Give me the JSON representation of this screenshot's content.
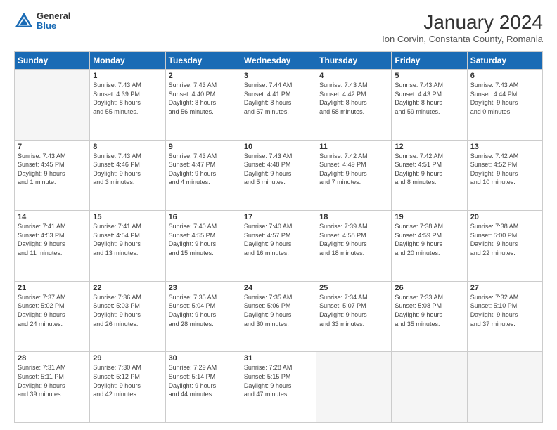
{
  "header": {
    "logo": {
      "general": "General",
      "blue": "Blue"
    },
    "month_year": "January 2024",
    "location": "Ion Corvin, Constanta County, Romania"
  },
  "days_of_week": [
    "Sunday",
    "Monday",
    "Tuesday",
    "Wednesday",
    "Thursday",
    "Friday",
    "Saturday"
  ],
  "weeks": [
    [
      {
        "day": "",
        "info": ""
      },
      {
        "day": "1",
        "info": "Sunrise: 7:43 AM\nSunset: 4:39 PM\nDaylight: 8 hours\nand 55 minutes."
      },
      {
        "day": "2",
        "info": "Sunrise: 7:43 AM\nSunset: 4:40 PM\nDaylight: 8 hours\nand 56 minutes."
      },
      {
        "day": "3",
        "info": "Sunrise: 7:44 AM\nSunset: 4:41 PM\nDaylight: 8 hours\nand 57 minutes."
      },
      {
        "day": "4",
        "info": "Sunrise: 7:43 AM\nSunset: 4:42 PM\nDaylight: 8 hours\nand 58 minutes."
      },
      {
        "day": "5",
        "info": "Sunrise: 7:43 AM\nSunset: 4:43 PM\nDaylight: 8 hours\nand 59 minutes."
      },
      {
        "day": "6",
        "info": "Sunrise: 7:43 AM\nSunset: 4:44 PM\nDaylight: 9 hours\nand 0 minutes."
      }
    ],
    [
      {
        "day": "7",
        "info": "Sunrise: 7:43 AM\nSunset: 4:45 PM\nDaylight: 9 hours\nand 1 minute."
      },
      {
        "day": "8",
        "info": "Sunrise: 7:43 AM\nSunset: 4:46 PM\nDaylight: 9 hours\nand 3 minutes."
      },
      {
        "day": "9",
        "info": "Sunrise: 7:43 AM\nSunset: 4:47 PM\nDaylight: 9 hours\nand 4 minutes."
      },
      {
        "day": "10",
        "info": "Sunrise: 7:43 AM\nSunset: 4:48 PM\nDaylight: 9 hours\nand 5 minutes."
      },
      {
        "day": "11",
        "info": "Sunrise: 7:42 AM\nSunset: 4:49 PM\nDaylight: 9 hours\nand 7 minutes."
      },
      {
        "day": "12",
        "info": "Sunrise: 7:42 AM\nSunset: 4:51 PM\nDaylight: 9 hours\nand 8 minutes."
      },
      {
        "day": "13",
        "info": "Sunrise: 7:42 AM\nSunset: 4:52 PM\nDaylight: 9 hours\nand 10 minutes."
      }
    ],
    [
      {
        "day": "14",
        "info": "Sunrise: 7:41 AM\nSunset: 4:53 PM\nDaylight: 9 hours\nand 11 minutes."
      },
      {
        "day": "15",
        "info": "Sunrise: 7:41 AM\nSunset: 4:54 PM\nDaylight: 9 hours\nand 13 minutes."
      },
      {
        "day": "16",
        "info": "Sunrise: 7:40 AM\nSunset: 4:55 PM\nDaylight: 9 hours\nand 15 minutes."
      },
      {
        "day": "17",
        "info": "Sunrise: 7:40 AM\nSunset: 4:57 PM\nDaylight: 9 hours\nand 16 minutes."
      },
      {
        "day": "18",
        "info": "Sunrise: 7:39 AM\nSunset: 4:58 PM\nDaylight: 9 hours\nand 18 minutes."
      },
      {
        "day": "19",
        "info": "Sunrise: 7:38 AM\nSunset: 4:59 PM\nDaylight: 9 hours\nand 20 minutes."
      },
      {
        "day": "20",
        "info": "Sunrise: 7:38 AM\nSunset: 5:00 PM\nDaylight: 9 hours\nand 22 minutes."
      }
    ],
    [
      {
        "day": "21",
        "info": "Sunrise: 7:37 AM\nSunset: 5:02 PM\nDaylight: 9 hours\nand 24 minutes."
      },
      {
        "day": "22",
        "info": "Sunrise: 7:36 AM\nSunset: 5:03 PM\nDaylight: 9 hours\nand 26 minutes."
      },
      {
        "day": "23",
        "info": "Sunrise: 7:35 AM\nSunset: 5:04 PM\nDaylight: 9 hours\nand 28 minutes."
      },
      {
        "day": "24",
        "info": "Sunrise: 7:35 AM\nSunset: 5:06 PM\nDaylight: 9 hours\nand 30 minutes."
      },
      {
        "day": "25",
        "info": "Sunrise: 7:34 AM\nSunset: 5:07 PM\nDaylight: 9 hours\nand 33 minutes."
      },
      {
        "day": "26",
        "info": "Sunrise: 7:33 AM\nSunset: 5:08 PM\nDaylight: 9 hours\nand 35 minutes."
      },
      {
        "day": "27",
        "info": "Sunrise: 7:32 AM\nSunset: 5:10 PM\nDaylight: 9 hours\nand 37 minutes."
      }
    ],
    [
      {
        "day": "28",
        "info": "Sunrise: 7:31 AM\nSunset: 5:11 PM\nDaylight: 9 hours\nand 39 minutes."
      },
      {
        "day": "29",
        "info": "Sunrise: 7:30 AM\nSunset: 5:12 PM\nDaylight: 9 hours\nand 42 minutes."
      },
      {
        "day": "30",
        "info": "Sunrise: 7:29 AM\nSunset: 5:14 PM\nDaylight: 9 hours\nand 44 minutes."
      },
      {
        "day": "31",
        "info": "Sunrise: 7:28 AM\nSunset: 5:15 PM\nDaylight: 9 hours\nand 47 minutes."
      },
      {
        "day": "",
        "info": ""
      },
      {
        "day": "",
        "info": ""
      },
      {
        "day": "",
        "info": ""
      }
    ]
  ]
}
